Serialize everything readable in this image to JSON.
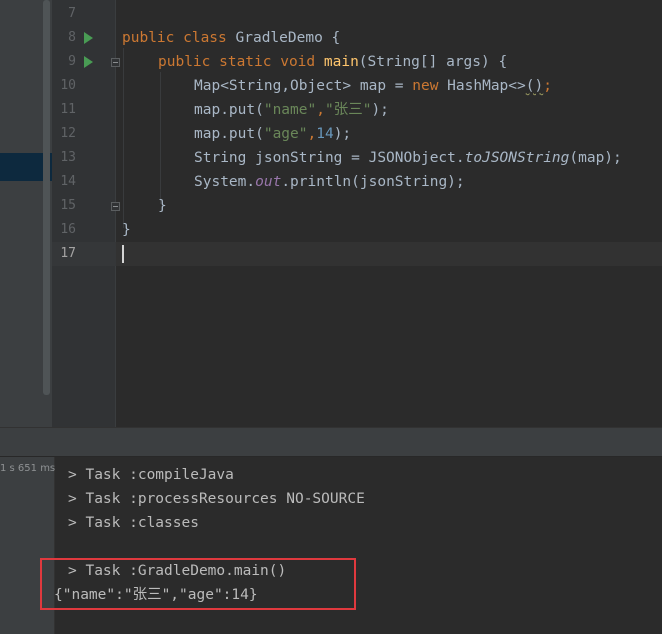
{
  "editor": {
    "line_numbers": [
      "7",
      "8",
      "9",
      "10",
      "11",
      "12",
      "13",
      "14",
      "15",
      "16",
      "17"
    ],
    "current_line": "17",
    "lines": {
      "l8": {
        "kw1": "public class ",
        "name": "GradleDemo",
        "rest": " {"
      },
      "l9": {
        "kw1": "public static void ",
        "fn": "main",
        "rest": "(String[] args) {"
      },
      "l10": {
        "pre": "Map<String,Object> map = ",
        "kw": "new ",
        "cls": "HashMap<>",
        "paren": "()",
        "semi": ";"
      },
      "l11": {
        "pre": "map.put(",
        "s1": "\"name\"",
        "comma": ",",
        "s2": "\"张三\"",
        "post": ");"
      },
      "l12": {
        "pre": "map.put(",
        "s1": "\"age\"",
        "comma": ",",
        "num": "14",
        "post": ");"
      },
      "l13": {
        "pre": "String jsonString = JSONObject.",
        "ital": "toJSONString",
        "post": "(map);"
      },
      "l14": {
        "pre": "System.",
        "field": "out",
        "post": ".println(jsonString);"
      },
      "l15": "}",
      "l16": "}"
    }
  },
  "console": {
    "timing": "1 s 651 ms",
    "lines": [
      "> Task :compileJava",
      "> Task :processResources NO-SOURCE",
      "> Task :classes",
      "",
      "> Task :GradleDemo.main()",
      "{\"name\":\"张三\",\"age\":14}"
    ]
  },
  "colors": {
    "keyword": "#cc7832",
    "method": "#ffc66d",
    "string": "#6a8759",
    "number": "#6897bb",
    "field": "#9876aa",
    "text": "#a9b7c6",
    "highlight_box": "#e0393e",
    "run_icon": "#499c54"
  },
  "icons": {
    "run": "run-gutter-icon",
    "fold": "fold-icon"
  }
}
